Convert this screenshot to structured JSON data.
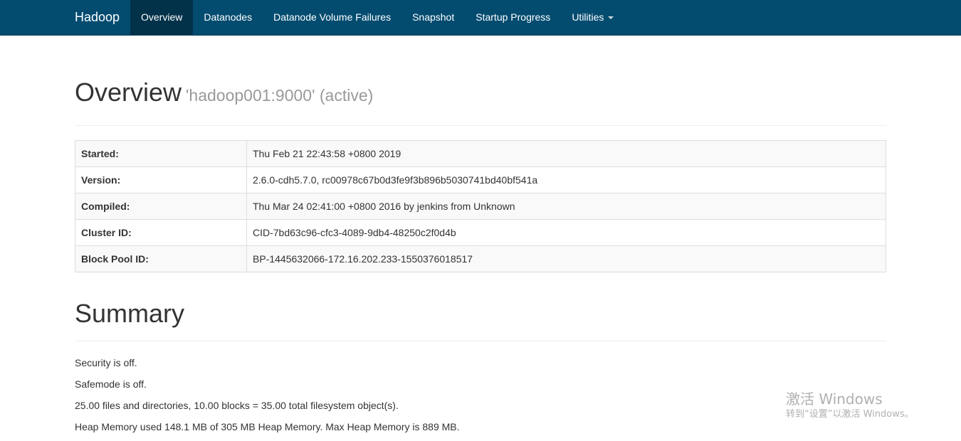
{
  "navbar": {
    "brand": "Hadoop",
    "items": [
      {
        "label": "Overview",
        "active": true
      },
      {
        "label": "Datanodes",
        "active": false
      },
      {
        "label": "Datanode Volume Failures",
        "active": false
      },
      {
        "label": "Snapshot",
        "active": false
      },
      {
        "label": "Startup Progress",
        "active": false
      },
      {
        "label": "Utilities",
        "active": false
      }
    ],
    "colors": {
      "background": "#034c70",
      "active": "#02314a"
    }
  },
  "overview": {
    "title": "Overview",
    "subtitle": "'hadoop001:9000' (active)",
    "rows": [
      {
        "label": "Started:",
        "value": "Thu Feb 21 22:43:58 +0800 2019"
      },
      {
        "label": "Version:",
        "value": "2.6.0-cdh5.7.0, rc00978c67b0d3fe9f3b896b5030741bd40bf541a"
      },
      {
        "label": "Compiled:",
        "value": "Thu Mar 24 02:41:00 +0800 2016 by jenkins from Unknown"
      },
      {
        "label": "Cluster ID:",
        "value": "CID-7bd63c96-cfc3-4089-9db4-48250c2f0d4b"
      },
      {
        "label": "Block Pool ID:",
        "value": "BP-1445632066-172.16.202.233-1550376018517"
      }
    ]
  },
  "summary": {
    "title": "Summary",
    "lines": [
      "Security is off.",
      "Safemode is off.",
      "25.00 files and directories, 10.00 blocks = 35.00 total filesystem object(s).",
      "Heap Memory used 148.1 MB of 305 MB Heap Memory. Max Heap Memory is 889 MB."
    ]
  },
  "watermark": {
    "title": "激活 Windows",
    "subtitle": "转到“设置”以激活 Windows。"
  }
}
